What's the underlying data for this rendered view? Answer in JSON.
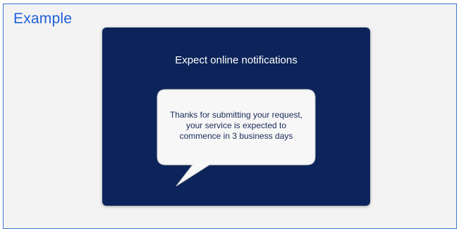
{
  "header": {
    "label": "Example"
  },
  "card": {
    "title": "Expect online notifications",
    "bubble": {
      "line1": "Thanks for submitting your request,",
      "line2": "your service is expected to",
      "line3": "commence in 3 business days"
    }
  },
  "colors": {
    "frame_border": "#3b73d1",
    "label": "#1f5fd6",
    "card_bg": "#0c2459",
    "bubble_bg": "#f7f7f7"
  }
}
